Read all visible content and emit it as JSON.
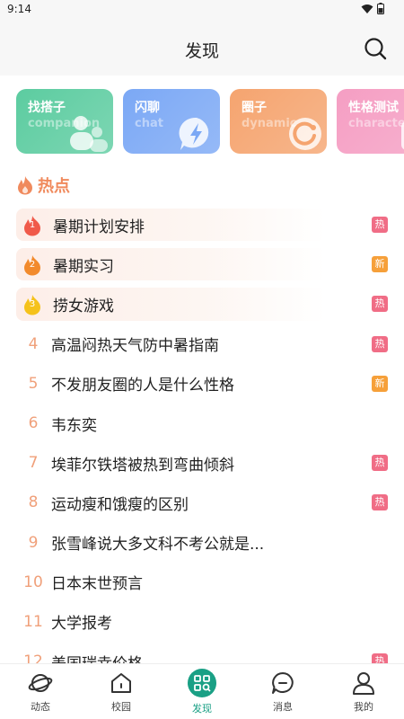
{
  "status": {
    "time": "9:14"
  },
  "header": {
    "title": "发现"
  },
  "cards": [
    {
      "title": "找搭子",
      "sub": "companion",
      "color": "#5ccca0"
    },
    {
      "title": "闪聊",
      "sub": "chat",
      "color": "#7ba8f5"
    },
    {
      "title": "圈子",
      "sub": "dynamic",
      "color": "#f5a46f"
    },
    {
      "title": "性格测试",
      "sub": "character",
      "color": "#f59ec3"
    }
  ],
  "hot": {
    "title": "热点",
    "accent": "#f08a5d"
  },
  "list": [
    {
      "rank": "1",
      "text": "暑期计划安排",
      "tag": "热"
    },
    {
      "rank": "2",
      "text": "暑期实习",
      "tag": "新"
    },
    {
      "rank": "3",
      "text": "捞女游戏",
      "tag": "热"
    },
    {
      "rank": "4",
      "text": "高温闷热天气防中暑指南",
      "tag": "热"
    },
    {
      "rank": "5",
      "text": "不发朋友圈的人是什么性格",
      "tag": "新"
    },
    {
      "rank": "6",
      "text": "韦东奕",
      "tag": ""
    },
    {
      "rank": "7",
      "text": "埃菲尔铁塔被热到弯曲倾斜",
      "tag": "热"
    },
    {
      "rank": "8",
      "text": "运动瘦和饿瘦的区别",
      "tag": "热"
    },
    {
      "rank": "9",
      "text": "张雪峰说大多文科不考公就是...",
      "tag": ""
    },
    {
      "rank": "10",
      "text": "日本末世预言",
      "tag": ""
    },
    {
      "rank": "11",
      "text": "大学报考",
      "tag": ""
    },
    {
      "rank": "12",
      "text": "美国瑞幸价格",
      "tag": "热"
    }
  ],
  "tag_colors": {
    "热": "#f06d86",
    "新": "#f6a03a"
  },
  "rank_colors": [
    "#f05a4a",
    "#f28a2c",
    "#f5c21b"
  ],
  "tabs": [
    {
      "label": "动态"
    },
    {
      "label": "校园"
    },
    {
      "label": "发现"
    },
    {
      "label": "消息"
    },
    {
      "label": "我的"
    }
  ],
  "active_tab": 2,
  "accent": "#1aa085"
}
